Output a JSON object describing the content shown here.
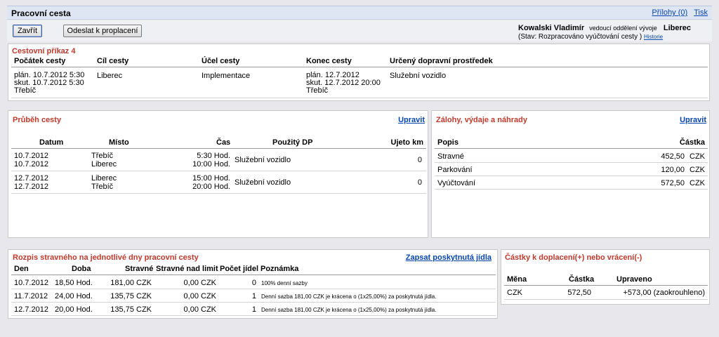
{
  "window": {
    "title": "Pracovní cesta",
    "links": [
      "Přílohy (0)",
      "Tisk"
    ]
  },
  "toolbar": {
    "close_label": "Zavřít",
    "send_label": "Odeslat k proplacení"
  },
  "user": {
    "name": "Kowalski Vladimír",
    "role": "vedoucí oddělení vývoje",
    "city": "Liberec",
    "status": "(Stav: Rozpracováno vyúčtování cesty )",
    "history": "Historie"
  },
  "order": {
    "title": "Cestovní příkaz  4",
    "headers": [
      "Počátek cesty",
      "Cíl cesty",
      "Účel cesty",
      "Konec cesty",
      "Určený dopravní prostředek"
    ],
    "start": [
      "plán. 10.7.2012 5:30",
      "skut. 10.7.2012 5:30",
      "Třebíč"
    ],
    "target": "Liberec",
    "purpose": "Implementace",
    "end": [
      "plán. 12.7.2012",
      "skut. 12.7.2012 20:00",
      "Třebíč"
    ],
    "transport": "Služební vozidlo"
  },
  "trip": {
    "title": "Průběh cesty",
    "edit": "Upravit",
    "headers": [
      "Datum",
      "Místo",
      "Čas",
      "Použitý DP",
      "Ujeto km"
    ],
    "rows": [
      {
        "dates": [
          "10.7.2012",
          "10.7.2012"
        ],
        "places": [
          "Třebíč",
          "Liberec"
        ],
        "times": [
          "5:30 Hod.",
          "10:00 Hod."
        ],
        "dp": "Služební vozidlo",
        "km": "0"
      },
      {
        "dates": [
          "12.7.2012",
          "12.7.2012"
        ],
        "places": [
          "Liberec",
          "Třebíč"
        ],
        "times": [
          "15:00 Hod.",
          "20:00 Hod."
        ],
        "dp": "Služební vozidlo",
        "km": "0"
      }
    ]
  },
  "advances": {
    "title": "Zálohy, výdaje a náhrady",
    "edit": "Upravit",
    "headers": [
      "Popis",
      "Částka"
    ],
    "rows": [
      {
        "label": "Stravné",
        "amount": "452,50",
        "cur": "CZK"
      },
      {
        "label": "Parkování",
        "amount": "120,00",
        "cur": "CZK"
      },
      {
        "label": "Vyúčtování",
        "amount": "572,50",
        "cur": "CZK"
      }
    ]
  },
  "meals": {
    "title": "Rozpis stravného na jednotlivé dny pracovní cesty",
    "action": "Zapsat poskytnutá jídla",
    "headers": [
      "Den",
      "Doba",
      "Stravné",
      "Stravné nad limit",
      "Počet jídel",
      "Poznámka"
    ],
    "rows": [
      {
        "day": "10.7.2012",
        "dur": "18,50 Hod.",
        "meal": "181,00 CZK",
        "over": "0,00 CZK",
        "count": "0",
        "note": "100% denní sazby"
      },
      {
        "day": "11.7.2012",
        "dur": "24,00 Hod.",
        "meal": "135,75 CZK",
        "over": "0,00 CZK",
        "count": "1",
        "note": "Denní sazba 181,00 CZK je krácena o (1x25,00%) za poskytnutá jídla."
      },
      {
        "day": "12.7.2012",
        "dur": "20,00 Hod.",
        "meal": "135,75 CZK",
        "over": "0,00 CZK",
        "count": "1",
        "note": "Denní sazba 181,00 CZK je krácena o (1x25,00%) za poskytnutá jídla."
      }
    ]
  },
  "settle": {
    "title": "Částky k doplacení(+) nebo vrácení(-)",
    "headers": [
      "Měna",
      "Částka",
      "Upraveno"
    ],
    "row": {
      "cur": "CZK",
      "amount": "572,50",
      "adjusted": "+573,00  (zaokrouhleno)"
    }
  }
}
